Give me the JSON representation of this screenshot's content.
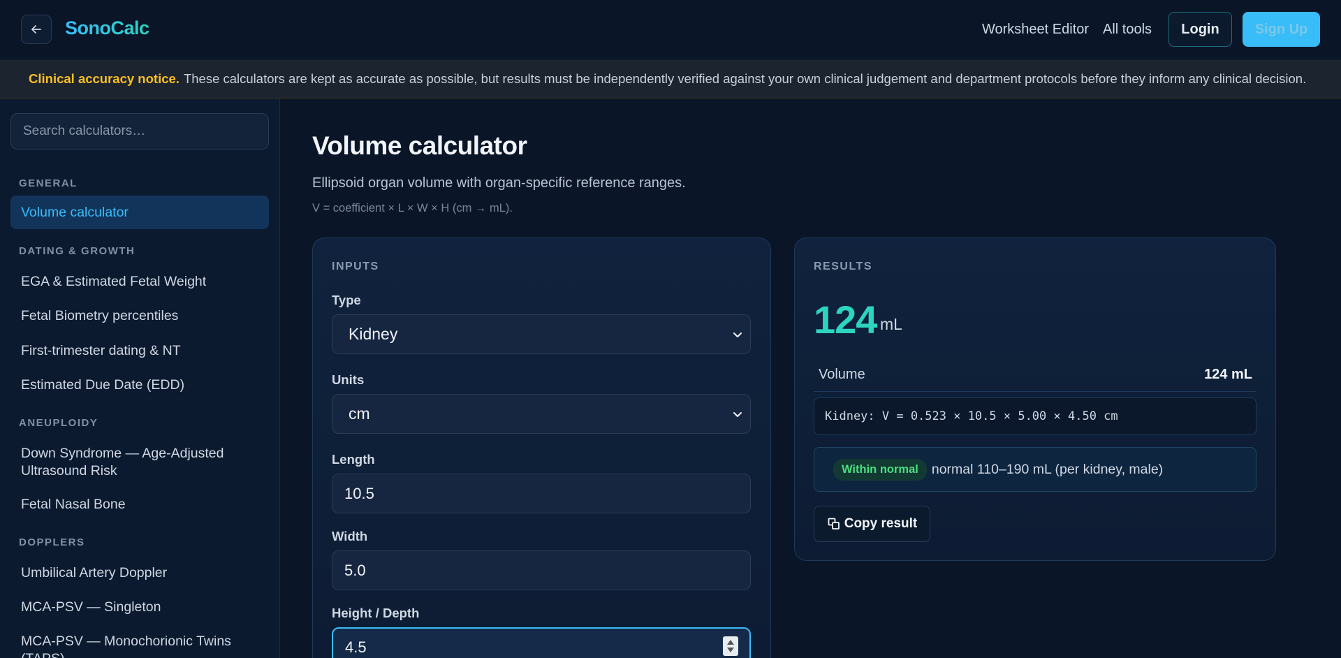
{
  "header": {
    "brand": "SonoCalc",
    "nav": [
      "Worksheet Editor",
      "All tools"
    ],
    "login_label": "Login",
    "signup_label": "Sign Up"
  },
  "notice": {
    "strong": "Clinical accuracy notice.",
    "text": "These calculators are kept as accurate as possible, but results must be independently verified against your own clinical judgement and department protocols before they inform any clinical decision."
  },
  "sidebar": {
    "search_placeholder": "Search calculators…",
    "sections": {
      "general": "GENERAL",
      "dating": "DATING & GROWTH",
      "aneuploidy": "ANEUPLOIDY",
      "dopplers": "DOPPLERS"
    },
    "items": [
      "Volume calculator",
      "EGA & Estimated Fetal Weight",
      "Fetal Biometry percentiles",
      "First-trimester dating & NT",
      "Estimated Due Date (EDD)",
      "Down Syndrome — Age-Adjusted Ultrasound Risk",
      "Fetal Nasal Bone",
      "Umbilical Artery Doppler",
      "MCA-PSV — Singleton",
      "MCA-PSV — Monochorionic Twins (TAPS)"
    ]
  },
  "main": {
    "title": "Volume calculator",
    "subtitle": "Ellipsoid organ volume with organ-specific reference ranges.",
    "formula_note": "V = coefficient × L × W × H (cm → mL)."
  },
  "inputs": {
    "heading": "INPUTS",
    "type_label": "Type",
    "type_value": "Kidney",
    "units_label": "Units",
    "units_value": "cm",
    "length_label": "Length",
    "length_value": "10.5",
    "width_label": "Width",
    "width_value": "5.0",
    "height_label": "Height / Depth",
    "height_value": "4.5"
  },
  "results": {
    "heading": "RESULTS",
    "big_value": "124",
    "big_unit": "mL",
    "volume_label": "Volume",
    "volume_value": "124 mL",
    "formula": "Kidney: V = 0.523 × 10.5 × 5.00 × 4.50 cm",
    "badge": "Within normal",
    "range_text": "normal 110–190 mL (per kidney, male)",
    "copy_label": "Copy result"
  },
  "colors": {
    "accent": "#38bdf8",
    "teal": "#2dd4bf",
    "warning": "#fbbf24",
    "success": "#4ade80",
    "background": "#0a1628"
  }
}
